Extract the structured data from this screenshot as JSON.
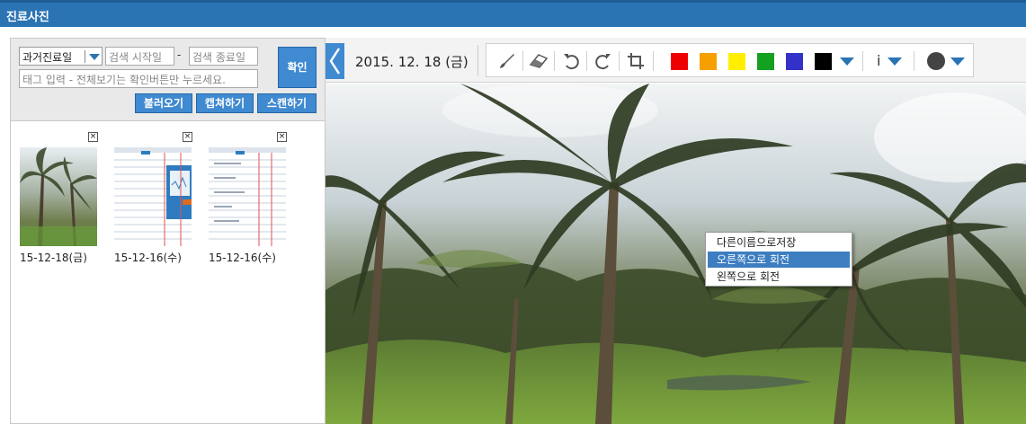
{
  "window": {
    "title": "진료사진"
  },
  "search": {
    "filter_value": "과거진료일",
    "start_placeholder": "검색 시작일",
    "end_placeholder": "검색 종료일",
    "range_separator": "-",
    "tag_placeholder": "태그 입력 - 전체보기는 확인버튼만 누르세요.",
    "confirm_label": "확인",
    "buttons": {
      "load": "불러오기",
      "capture": "캡쳐하기",
      "scan": "스캔하기"
    }
  },
  "thumbnails": [
    {
      "label": "15-12-18(금)",
      "close": "×"
    },
    {
      "label": "15-12-16(수)",
      "close": "×"
    },
    {
      "label": "15-12-16(수)",
      "close": "×"
    }
  ],
  "viewer": {
    "date": "2015. 12. 18 (금)",
    "tool_icons": [
      "brush-icon",
      "eraser-icon",
      "undo-icon",
      "redo-icon",
      "crop-icon"
    ],
    "colors": [
      "#ee0000",
      "#f5a000",
      "#ffee00",
      "#14a020",
      "#3232c8",
      "#000000"
    ],
    "info_glyph": "i"
  },
  "context_menu": {
    "items": [
      "다른이름으로저장",
      "오른쪽으로 회전",
      "왼쪽으로 회전"
    ],
    "highlighted_index": 1
  }
}
